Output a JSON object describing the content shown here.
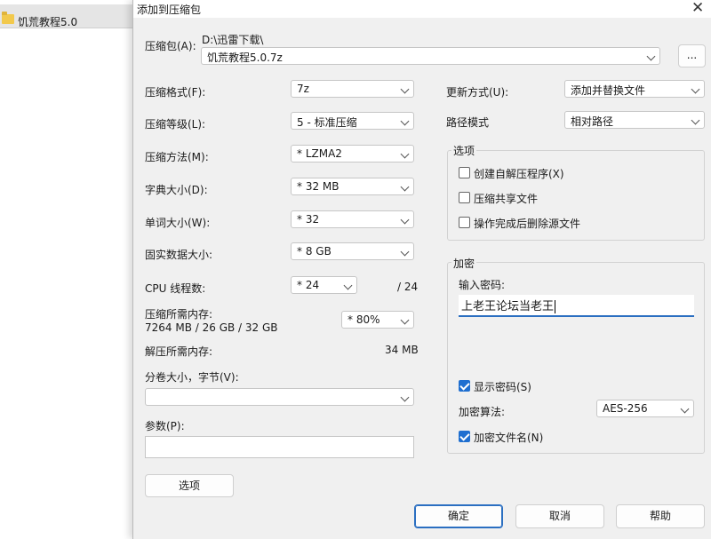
{
  "background": {
    "folder_label": "饥荒教程5.0"
  },
  "dialog": {
    "title": "添加到压缩包",
    "archive": {
      "label": "压缩包(A):",
      "path": "D:\\迅雷下载\\",
      "filename": "饥荒教程5.0.7z",
      "browse_label": "..."
    },
    "left": {
      "format": {
        "label": "压缩格式(F):",
        "value": "7z"
      },
      "level": {
        "label": "压缩等级(L):",
        "value": "5 - 标准压缩"
      },
      "method": {
        "label": "压缩方法(M):",
        "value": "* LZMA2"
      },
      "dict": {
        "label": "字典大小(D):",
        "value": "* 32 MB"
      },
      "word": {
        "label": "单词大小(W):",
        "value": "* 32"
      },
      "solid": {
        "label": "固实数据大小:",
        "value": "* 8 GB"
      },
      "cpu": {
        "label": "CPU 线程数:",
        "value": "* 24",
        "total": "/ 24"
      },
      "mem_comp": {
        "label": "压缩所需内存:",
        "detail": "7264 MB / 26 GB / 32 GB",
        "value": "* 80%"
      },
      "mem_decomp": {
        "label": "解压所需内存:",
        "value": "34 MB"
      },
      "split": {
        "label": "分卷大小，字节(V):",
        "value": ""
      },
      "params": {
        "label": "参数(P):",
        "value": ""
      },
      "options_button": "选项"
    },
    "right": {
      "update": {
        "label": "更新方式(U):",
        "value": "添加并替换文件"
      },
      "pathmode": {
        "label": "路径模式",
        "value": "相对路径"
      },
      "options_group": {
        "title": "选项",
        "sfx": "创建自解压程序(X)",
        "shared": "压缩共享文件",
        "delete": "操作完成后删除源文件"
      },
      "encrypt_group": {
        "title": "加密",
        "pwd_label": "输入密码:",
        "pwd_value": "上老王论坛当老王",
        "show_pwd": "显示密码(S)",
        "method_label": "加密算法:",
        "method_value": "AES-256",
        "encrypt_names": "加密文件名(N)"
      }
    },
    "buttons": {
      "ok": "确定",
      "cancel": "取消",
      "help": "帮助"
    },
    "colors": {
      "accent": "#1f6fd0",
      "dialog_bg": "#f0f0f0"
    }
  }
}
